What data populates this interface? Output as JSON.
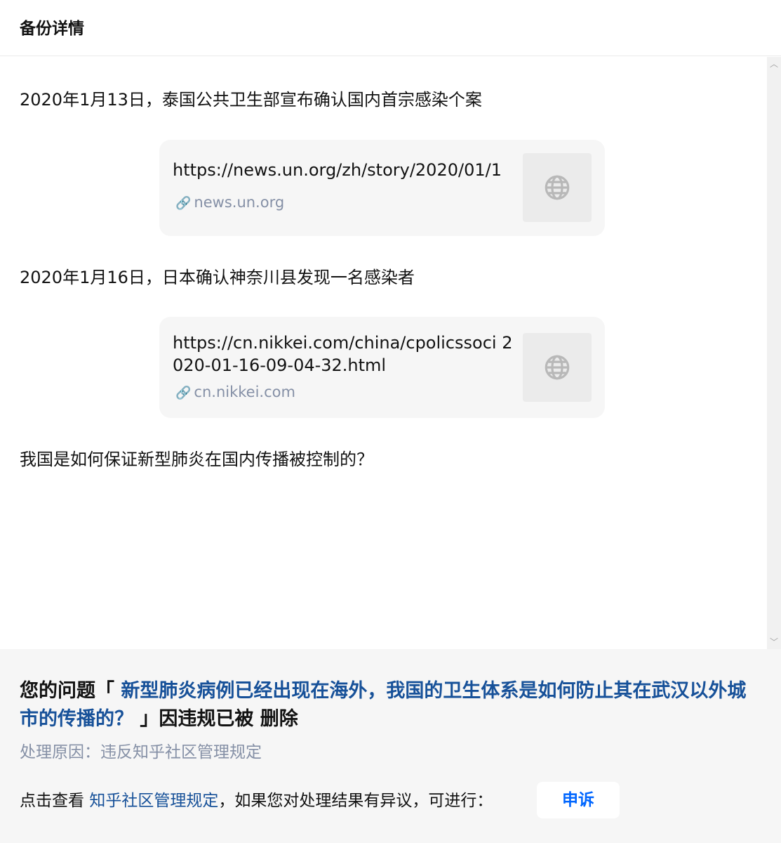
{
  "header": {
    "title": "备份详情"
  },
  "content": {
    "paragraph_1": "2020年1月13日，泰国公共卫生部宣布确认国内首宗感染个案",
    "link_card_1": {
      "title": "https://news.un.org/zh/story/2020/01/1",
      "host": "news.un.org",
      "icon": "globe-icon"
    },
    "paragraph_2": "2020年1月16日，日本确认神奈川县发现一名感染者",
    "link_card_2": {
      "title": "https://cn.nikkei.com/china/cpolicssoci 2020-01-16-09-04-32.html",
      "host": "cn.nikkei.com",
      "icon": "globe-icon"
    },
    "paragraph_3": "我国是如何保证新型肺炎在国内传播被控制的？"
  },
  "footer": {
    "notice_prefix": "您的问题「 ",
    "question_title": "新型肺炎病例已经出现在海外，我国的卫生体系是如何防止其在武汉以外城市的传播的？",
    "notice_suffix": " 」因违规已被 删除",
    "reason": "处理原因：违反知乎社区管理规定",
    "hint_prefix": "点击查看 ",
    "rules_link": "知乎社区管理规定",
    "hint_suffix": "，如果您对处理结果有异议，可进行：",
    "appeal_label": "申诉"
  },
  "colors": {
    "link_blue": "#175199",
    "accent_blue": "#0066ff",
    "muted_gray": "#8590a6",
    "card_bg": "#f6f6f6"
  }
}
